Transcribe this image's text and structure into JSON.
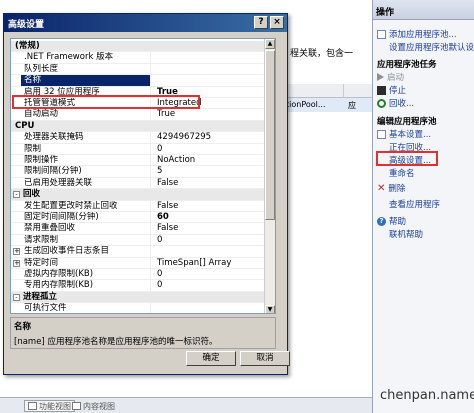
{
  "dialog": {
    "title": "高级设置",
    "help_label": "?",
    "close_label": "×",
    "ok_label": "确定",
    "cancel_label": "取消",
    "description": {
      "title": "名称",
      "text": "[name] 应用程序池名称是应用程序池的唯一标识符。"
    },
    "grid": {
      "cat_general": "(常规)",
      "cat_cpu": "CPU",
      "cat_recycle": "回收",
      "cat_process": "进程孤立",
      "rows": {
        "clr": {
          "name": ".NET Framework 版本",
          "value": ""
        },
        "queue": {
          "name": "队列长度",
          "value": ""
        },
        "name": {
          "name": "名称",
          "value": ""
        },
        "enable32": {
          "name": "启用 32 位应用程序",
          "value": "True"
        },
        "pipeline": {
          "name": "托管管道模式",
          "value": "Integrated"
        },
        "autostart": {
          "name": "自动启动",
          "value": "True"
        },
        "affinity": {
          "name": "处理器关联掩码",
          "value": "4294967295"
        },
        "limit": {
          "name": "限制",
          "value": "0"
        },
        "limit_action": {
          "name": "限制操作",
          "value": "NoAction"
        },
        "limit_interval": {
          "name": "限制间隔(分钟)",
          "value": "5"
        },
        "affinity_enabled": {
          "name": "已启用处理器关联",
          "value": "False"
        },
        "disable_config": {
          "name": "发生配置更改时禁止回收",
          "value": "False"
        },
        "fixed_interval": {
          "name": "固定时间间隔(分钟)",
          "value": "60"
        },
        "disable_overlap": {
          "name": "禁用重叠回收",
          "value": "False"
        },
        "request_limit": {
          "name": "请求限制",
          "value": "0"
        },
        "log_events": {
          "name": "生成回收事件日志条目",
          "value": ""
        },
        "specific_time": {
          "name": "特定时间",
          "value": "TimeSpan[] Array"
        },
        "vm_limit": {
          "name": "虚拟内存限制(KB)",
          "value": "0"
        },
        "private_limit": {
          "name": "专用内存限制(KB)",
          "value": "0"
        },
        "ping": {
          "name": "可执行文件",
          "value": ""
        }
      },
      "expander_plus": "+",
      "expander_minus": "-"
    }
  },
  "background": {
    "text1": "程关联，包含一",
    "row_text": "tionPool...",
    "row_cell2": "应"
  },
  "actions": {
    "header": "操作",
    "add_pool": "添加应用程序池...",
    "set_defaults": "设置应用程序池默认设置...",
    "section_tasks": "应用程序池任务",
    "start": "启动",
    "stop": "停止",
    "recycle": "回收...",
    "section_edit": "编辑应用程序池",
    "basic": "基本设置...",
    "recycling": "正在回收...",
    "advanced": "高级设置...",
    "rename": "重命名",
    "delete": "删除",
    "view_apps": "查看应用程序",
    "help": "帮助",
    "online_help": "联机帮助"
  },
  "status": {
    "feature_view": "功能视图",
    "content_view": "内容视图"
  },
  "watermark": "chenpan.name",
  "colors": {
    "titlebar": "#0a246a",
    "highlight_box": "#e03030",
    "selected_row": "#0a246a",
    "link": "#1a3f9c"
  }
}
